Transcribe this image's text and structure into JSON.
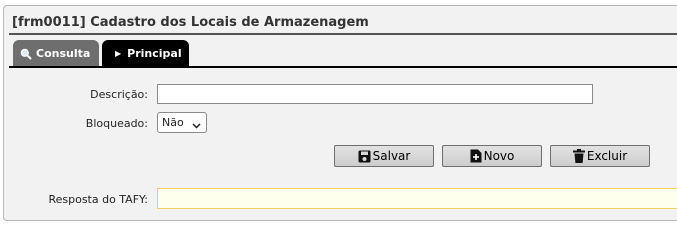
{
  "form": {
    "title": "[frm0011] Cadastro dos Locais de Armazenagem"
  },
  "tabs": [
    {
      "label": "Consulta",
      "icon": "search-icon"
    },
    {
      "label": "Principal",
      "icon": "caret-right-icon"
    }
  ],
  "fields": {
    "descricao": {
      "label": "Descrição:",
      "value": ""
    },
    "bloqueado": {
      "label": "Bloqueado:",
      "value": "Não"
    },
    "tafy": {
      "label": "Resposta do TAFY:",
      "value": ""
    }
  },
  "buttons": {
    "salvar": {
      "label": "Salvar",
      "icon": "save-icon"
    },
    "novo": {
      "label": "Novo",
      "icon": "new-document-icon"
    },
    "excluir": {
      "label": "Excluir",
      "icon": "trash-icon"
    }
  },
  "colors": {
    "active_tab": "#000000",
    "inactive_tab": "#6e6e6e",
    "highlight_field": "#ffffee"
  }
}
